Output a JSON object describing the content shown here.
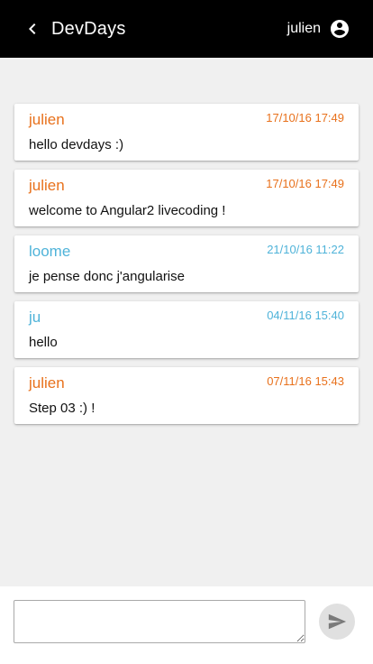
{
  "app": {
    "title": "DevDays",
    "username": "julien"
  },
  "colors": {
    "toolbar_bg": "#000000",
    "author_orange": "#e8711c",
    "author_blue": "#4fb3d9",
    "page_bg": "#f0f0f0"
  },
  "messages": [
    {
      "author": "julien",
      "date": "17/10/16 17:49",
      "text": "hello devdays :)",
      "color": "#e8711c"
    },
    {
      "author": "julien",
      "date": "17/10/16 17:49",
      "text": "welcome to Angular2 livecoding !",
      "color": "#e8711c"
    },
    {
      "author": "loome",
      "date": "21/10/16 11:22",
      "text": "je pense donc j'angularise",
      "color": "#4fb3d9"
    },
    {
      "author": "ju",
      "date": "04/11/16 15:40",
      "text": "hello",
      "color": "#4fb3d9"
    },
    {
      "author": "julien",
      "date": "07/11/16 15:43",
      "text": "Step 03 :) !",
      "color": "#e8711c"
    }
  ],
  "composer": {
    "value": "",
    "send_icon": "send-icon"
  },
  "icons": {
    "back": "chevron-left-icon",
    "account": "account-circle-icon",
    "send": "send-icon"
  }
}
